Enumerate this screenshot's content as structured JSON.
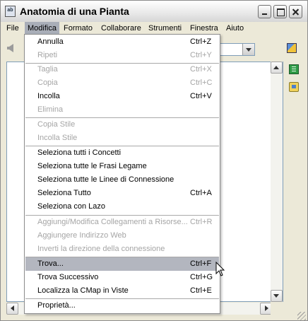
{
  "window": {
    "title": "Anatomia di una Pianta"
  },
  "menubar": {
    "items": [
      "File",
      "Modifica",
      "Formato",
      "Collaborare",
      "Strumenti",
      "Finestra",
      "Aiuto"
    ],
    "active": "Modifica"
  },
  "edit_menu": {
    "items": [
      {
        "label": "Annulla",
        "shortcut": "Ctrl+Z",
        "enabled": true
      },
      {
        "label": "Ripeti",
        "shortcut": "Ctrl+Y",
        "enabled": false
      },
      {
        "label": "Taglia",
        "shortcut": "Ctrl+X",
        "enabled": false
      },
      {
        "label": "Copia",
        "shortcut": "Ctrl+C",
        "enabled": false
      },
      {
        "label": "Incolla",
        "shortcut": "Ctrl+V",
        "enabled": true
      },
      {
        "label": "Elimina",
        "shortcut": "",
        "enabled": false
      },
      {
        "label": "Copia Stile",
        "shortcut": "",
        "enabled": false
      },
      {
        "label": "Incolla Stile",
        "shortcut": "",
        "enabled": false
      },
      {
        "label": "Seleziona tutti i Concetti",
        "shortcut": "",
        "enabled": true
      },
      {
        "label": "Seleziona tutte le Frasi Legame",
        "shortcut": "",
        "enabled": true
      },
      {
        "label": "Seleziona tutte le Linee di Connessione",
        "shortcut": "",
        "enabled": true
      },
      {
        "label": "Seleziona Tutto",
        "shortcut": "Ctrl+A",
        "enabled": true
      },
      {
        "label": "Seleziona con Lazo",
        "shortcut": "",
        "enabled": true
      },
      {
        "label": "Aggiungi/Modifica Collegamenti a Risorse...",
        "shortcut": "Ctrl+R",
        "enabled": false
      },
      {
        "label": "Aggiungere Indirizzo Web",
        "shortcut": "",
        "enabled": false
      },
      {
        "label": "Inverti la direzione della connessione",
        "shortcut": "",
        "enabled": false
      },
      {
        "label": "Trova...",
        "shortcut": "Ctrl+F",
        "enabled": true,
        "highlighted": true
      },
      {
        "label": "Trova Successivo",
        "shortcut": "Ctrl+G",
        "enabled": true
      },
      {
        "label": "Localizza la CMap in Viste",
        "shortcut": "Ctrl+E",
        "enabled": true
      },
      {
        "label": "Proprietà...",
        "shortcut": "",
        "enabled": true
      }
    ]
  },
  "icons": {
    "app": "concept-map-icon",
    "back": "back-arrow-icon",
    "right_toolbar": [
      "style-palette-icon",
      "views-book-icon",
      "collaboration-icon"
    ]
  },
  "colors": {
    "window_bg": "#ece9d8",
    "highlight": "#b3b6bf",
    "disabled_text": "#a5a5a5"
  }
}
